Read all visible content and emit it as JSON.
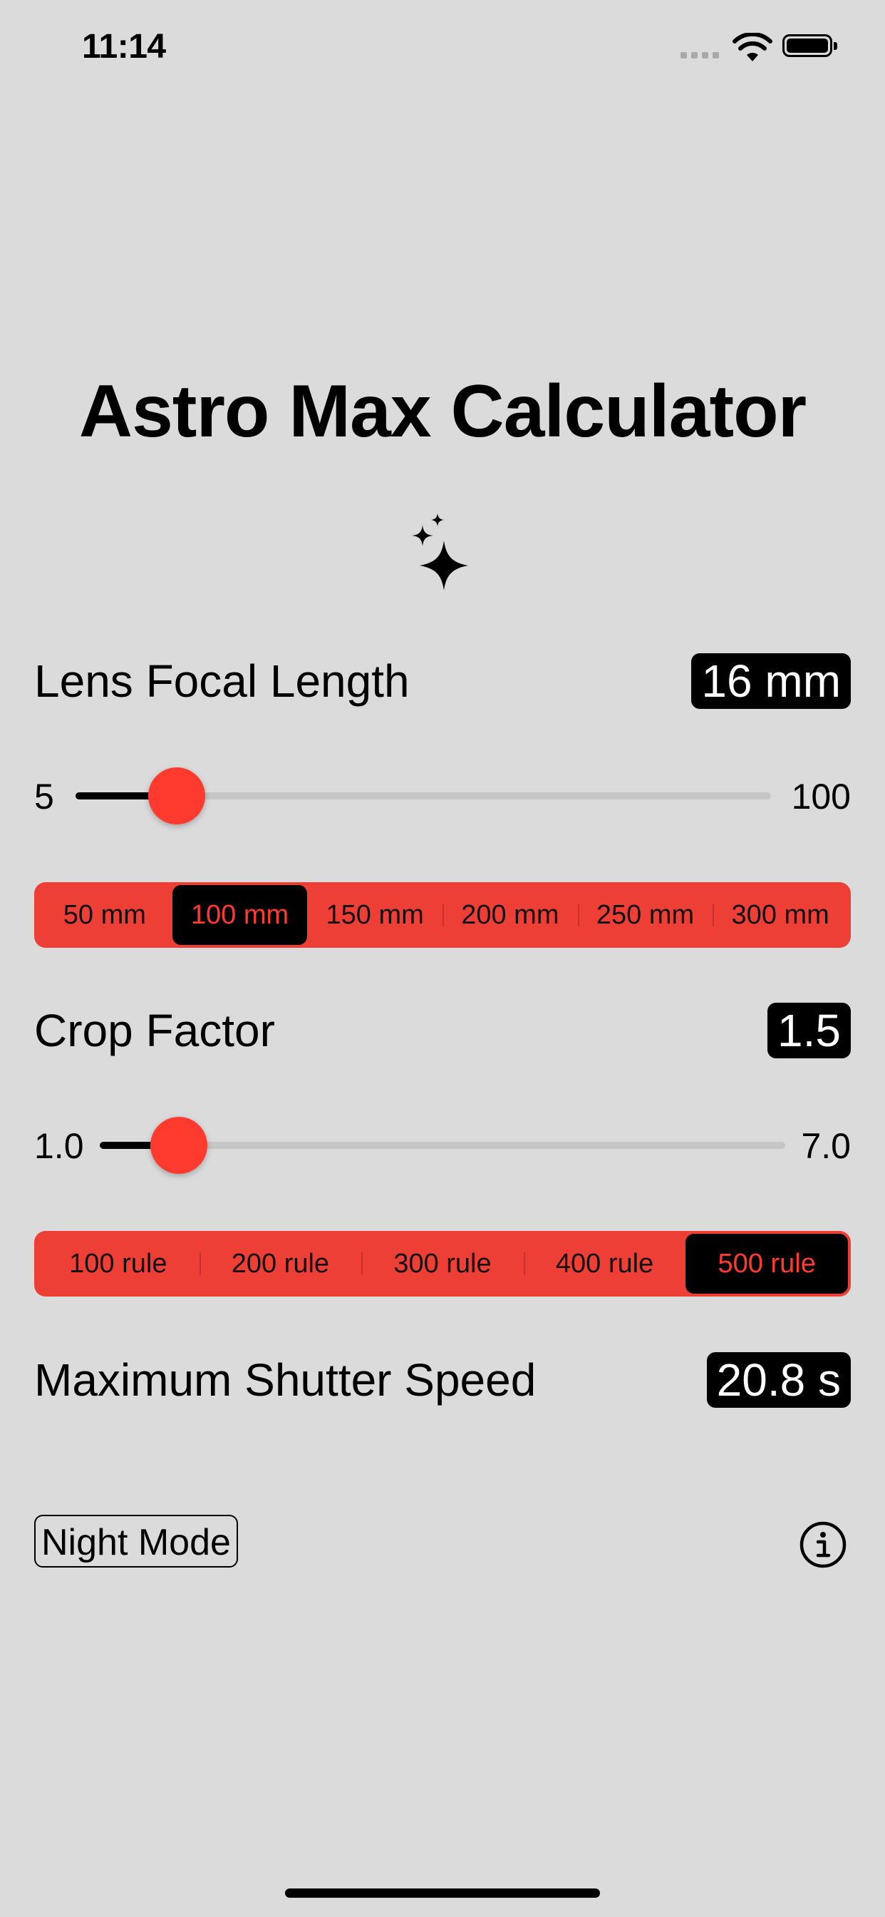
{
  "status_bar": {
    "time": "11:14",
    "icons": [
      "signal-dots-icon",
      "wifi-icon",
      "battery-icon"
    ]
  },
  "title": "Astro Max Calculator",
  "title_icon": "sparkles-icon",
  "focal_length": {
    "label": "Lens Focal Length",
    "value_display": "16 mm",
    "slider": {
      "min_label": "5",
      "max_label": "100",
      "min": 5,
      "max": 100,
      "value": 16
    },
    "presets": [
      {
        "label": "50 mm",
        "selected": false
      },
      {
        "label": "100 mm",
        "selected": true
      },
      {
        "label": "150 mm",
        "selected": false
      },
      {
        "label": "200 mm",
        "selected": false
      },
      {
        "label": "250 mm",
        "selected": false
      },
      {
        "label": "300 mm",
        "selected": false
      }
    ]
  },
  "crop_factor": {
    "label": "Crop Factor",
    "value_display": "1.5",
    "slider": {
      "min_label": "1.0",
      "max_label": "7.0",
      "min": 1.0,
      "max": 7.0,
      "value": 1.5
    },
    "rules": [
      {
        "label": "100 rule",
        "selected": false
      },
      {
        "label": "200 rule",
        "selected": false
      },
      {
        "label": "300 rule",
        "selected": false
      },
      {
        "label": "400 rule",
        "selected": false
      },
      {
        "label": "500 rule",
        "selected": true
      }
    ]
  },
  "shutter_speed": {
    "label": "Maximum Shutter Speed",
    "value_display": "20.8 s"
  },
  "night_mode_label": "Night Mode",
  "info_icon": "info-circle-icon",
  "colors": {
    "background": "#dbdbdb",
    "accent": "#ff3b30",
    "segment_background": "#ee3f37",
    "badge": "#000000",
    "track": "#c6c6c6"
  }
}
